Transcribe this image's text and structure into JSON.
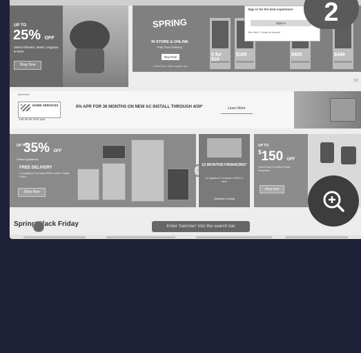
{
  "window_title": "",
  "step_badge": "2",
  "promo_left": {
    "up_to": "UP TO",
    "discount": "25%",
    "discount_suffix": "OFF",
    "desc": "Select Planters, Mulch, Irrigation & More",
    "button": "Shop Now"
  },
  "spring": {
    "logo": "SPRING",
    "in_store": "IN STORE & ONLINE",
    "sub": "Fast Free Delivery",
    "button": "Buy Now",
    "note": "Limited time. While supplies last."
  },
  "tiles": [
    {
      "price": "5 for $10"
    },
    {
      "price": "$199"
    },
    {
      "price": "$400"
    },
    {
      "price": "$449"
    }
  ],
  "sign_in": {
    "header": "Sign in for the best experience",
    "button": "Sign in",
    "link": "New Here? Create an account"
  },
  "row_thin_text": "1/2",
  "home_services": {
    "title": "Sponsored",
    "logo_name": "HOME SERVICES",
    "caption": "Let us do it for you.",
    "apr": "0% APR FOR 36 MONTHS ON NEW AC INSTALL THROUGH 4/30*",
    "learn_more": "Learn More"
  },
  "appliances": {
    "up_to": "UP TO",
    "discount": "35%",
    "discount_suffix": "OFF",
    "select": "Select Appliances",
    "free_delivery": "FREE DELIVERY",
    "free_desc": "On Appliance Purchases $396 or More. Details Online",
    "button": "Shop Now"
  },
  "financing": {
    "headline": "12 MONTHS FINANCING*",
    "desc": "On Appliance Purchases of $299 or More",
    "link": "Subscribe & Details"
  },
  "tools": {
    "up_to": "UP TO",
    "amount": "150",
    "amount_suffix": "OFF",
    "desc": "Select Tools & Outdoor Power Equipment",
    "button": "Shop Now"
  },
  "section_title": "Spring Black Friday",
  "tooltip": "Enter 'hammer' into the search bar",
  "icons": {
    "zoom": "zoom-in-icon",
    "plus": "plus-icon"
  }
}
